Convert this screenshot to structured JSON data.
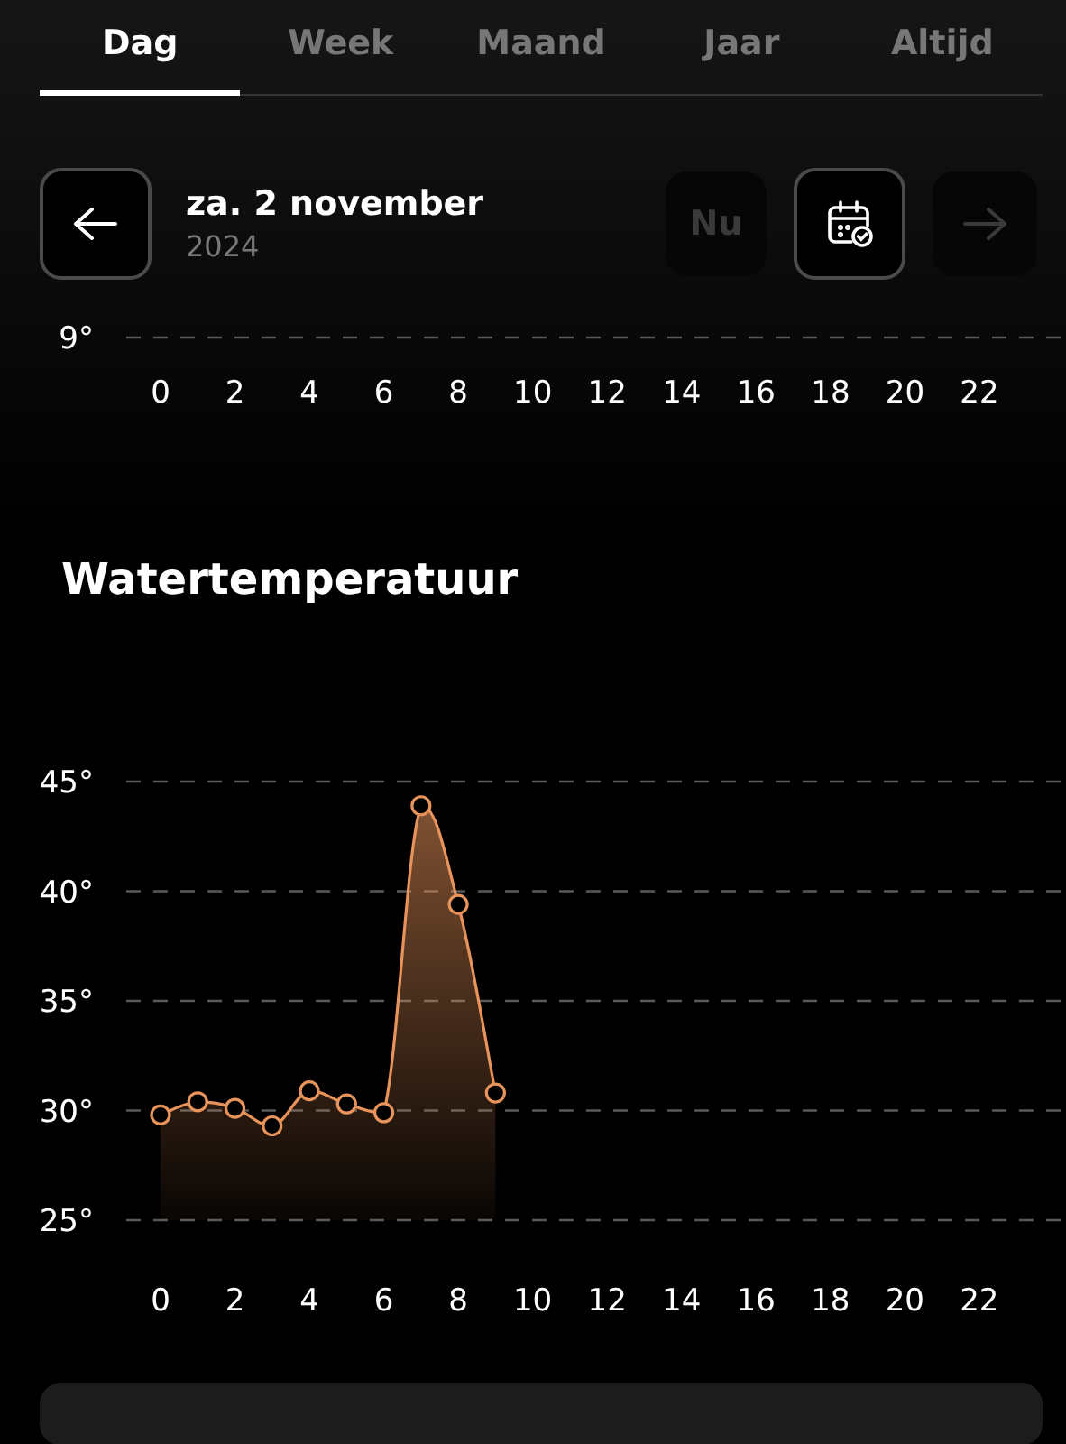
{
  "tabs": [
    {
      "label": "Dag",
      "selected": true
    },
    {
      "label": "Week",
      "selected": false
    },
    {
      "label": "Maand",
      "selected": false
    },
    {
      "label": "Jaar",
      "selected": false
    },
    {
      "label": "Altijd",
      "selected": false
    }
  ],
  "date_nav": {
    "back_button": {
      "disabled": false
    },
    "date": "za. 2 november",
    "year": "2024",
    "now_button": {
      "label": "Nu",
      "disabled": true
    },
    "calendar_button": {
      "disabled": false
    },
    "next_button": {
      "disabled": true
    }
  },
  "top_chart": {
    "yticks": [
      "9°"
    ],
    "xticks": [
      "0",
      "2",
      "4",
      "6",
      "8",
      "10",
      "12",
      "14",
      "16",
      "18",
      "20",
      "22"
    ]
  },
  "water_chart": {
    "title": "Watertemperatuur",
    "chart_data": {
      "type": "area",
      "x": [
        0,
        1,
        2,
        3,
        4,
        5,
        6,
        7,
        8,
        9
      ],
      "xlim": [
        -0.92,
        24.33
      ],
      "ylim": [
        25,
        45
      ],
      "grid": true,
      "series": [
        {
          "color": "#e8935a",
          "values": [
            29.8,
            30.4,
            30.1,
            29.3,
            30.9,
            30.3,
            29.9,
            43.9,
            39.4,
            30.8
          ]
        }
      ],
      "yticks": [
        {
          "value": 25,
          "label": "25°"
        },
        {
          "value": 30,
          "label": "30°"
        },
        {
          "value": 35,
          "label": "35°"
        },
        {
          "value": 40,
          "label": "40°"
        },
        {
          "value": 45,
          "label": "45°"
        }
      ],
      "xticks": [
        0,
        2,
        4,
        6,
        8,
        10,
        12,
        14,
        16,
        18,
        20,
        22
      ]
    }
  }
}
